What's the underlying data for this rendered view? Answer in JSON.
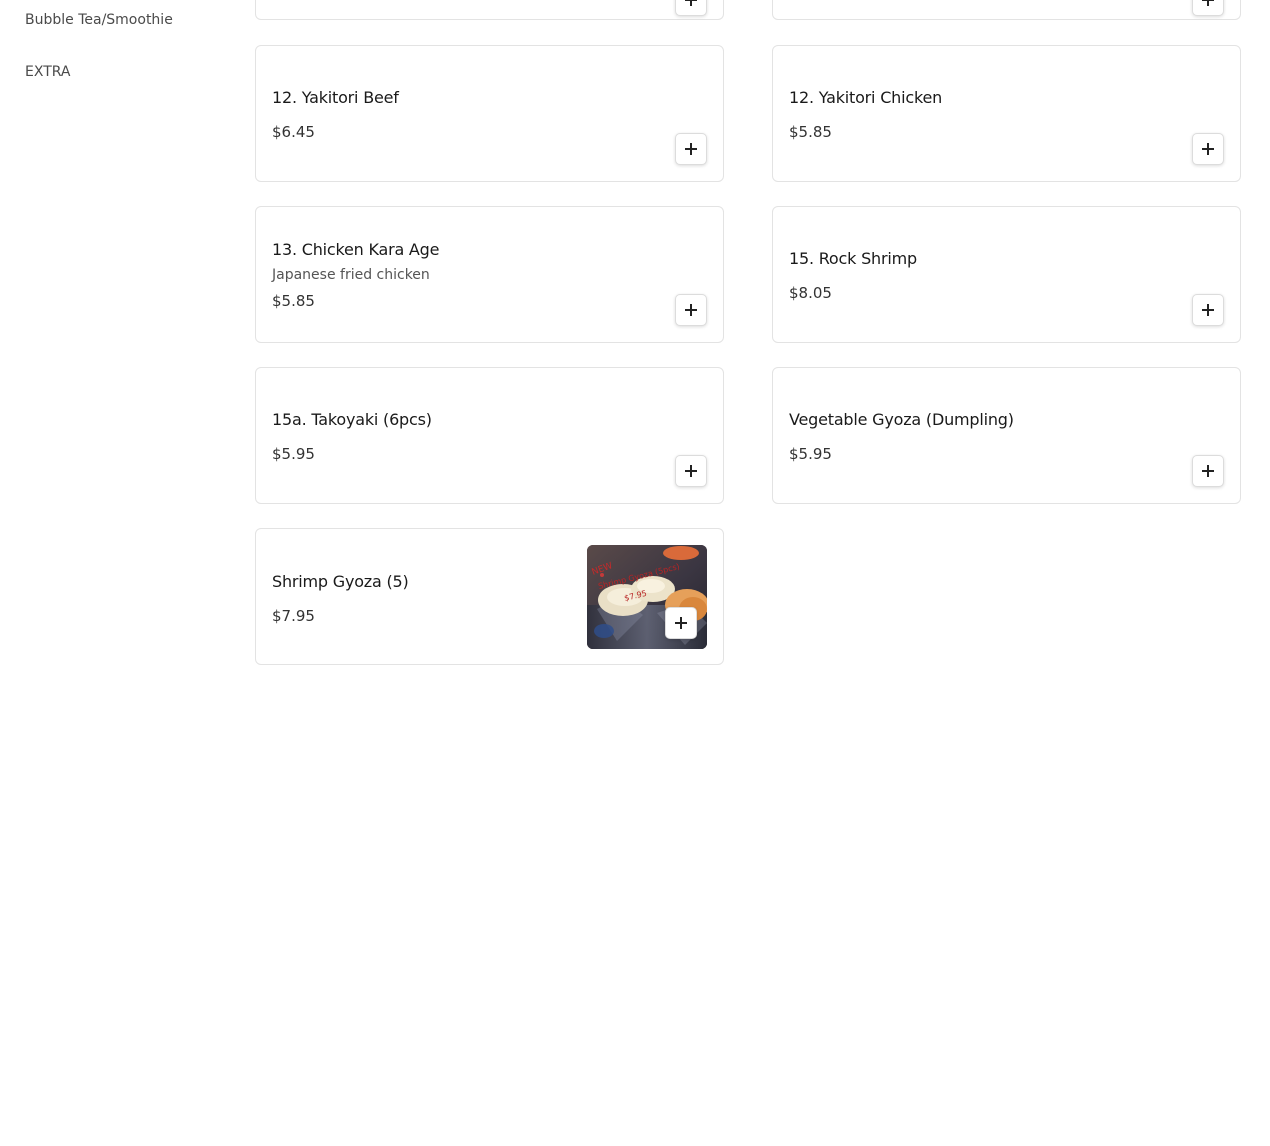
{
  "sidebar": {
    "items": [
      {
        "label": "Bubble Tea/Smoothie"
      },
      {
        "label": "EXTRA"
      }
    ]
  },
  "menu": {
    "items": [
      {
        "name": "12. Yakitori Beef",
        "price": "$6.45"
      },
      {
        "name": "12. Yakitori Chicken",
        "price": "$5.85"
      },
      {
        "name": "13. Chicken Kara Age",
        "description": "Japanese fried chicken",
        "price": "$5.85"
      },
      {
        "name": "15. Rock Shrimp",
        "price": "$8.05"
      },
      {
        "name": "15a. Takoyaki (6pcs)",
        "price": "$5.95"
      },
      {
        "name": "Vegetable Gyoza (Dumpling)",
        "price": "$5.95"
      },
      {
        "name": "Shrimp Gyoza (5)",
        "price": "$7.95"
      }
    ]
  },
  "photo_text": {
    "line1": "NEW",
    "line2": "Shrimp Gyoza (5pcs)",
    "line3": "$7.95"
  },
  "icons": {
    "add": "plus-icon"
  },
  "colors": {
    "border": "#e3e3e3",
    "text": "#1a1a1a",
    "muted": "#555555"
  }
}
